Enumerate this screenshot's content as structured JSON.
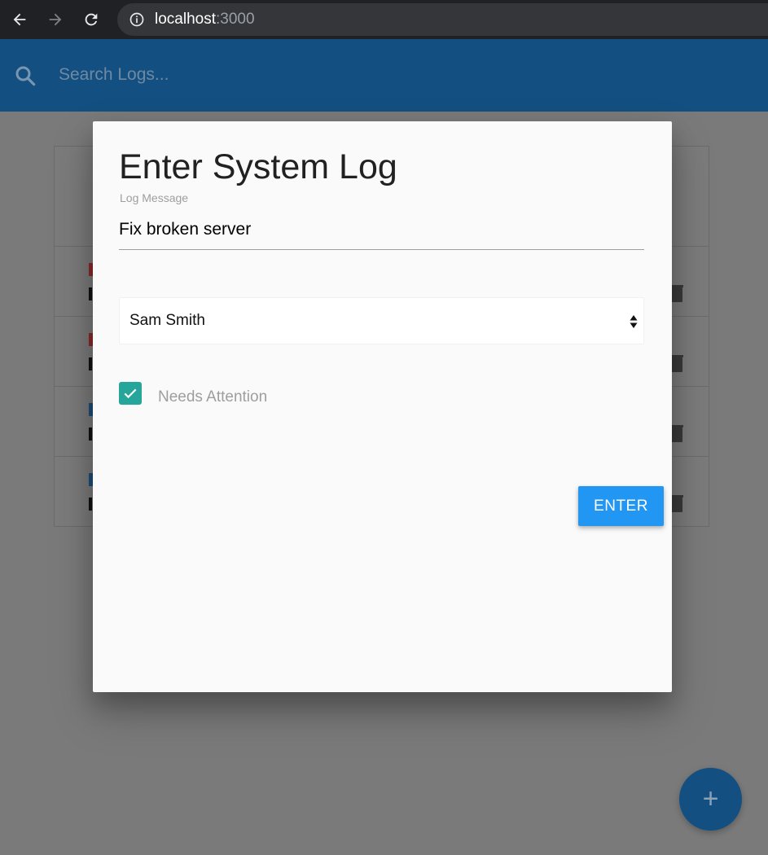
{
  "browser": {
    "url_host": "localhost",
    "url_port": ":3000",
    "icons": [
      "back-arrow-icon",
      "forward-arrow-icon",
      "reload-icon",
      "info-icon"
    ]
  },
  "navbar": {
    "search_placeholder": "Search Logs...",
    "color": "#1565c0",
    "icon": "search-icon"
  },
  "modal": {
    "title": "Enter System Log",
    "message_label": "Log Message",
    "message_value": "Fix broken server",
    "technician_selected": "Sam Smith",
    "attention_label": "Needs Attention",
    "attention_checked": true,
    "submit_label": "ENTER",
    "accent_checkbox": "#26a69a",
    "accent_button": "#2196f3"
  },
  "fab": {
    "label": "+",
    "icon": "add-icon"
  }
}
